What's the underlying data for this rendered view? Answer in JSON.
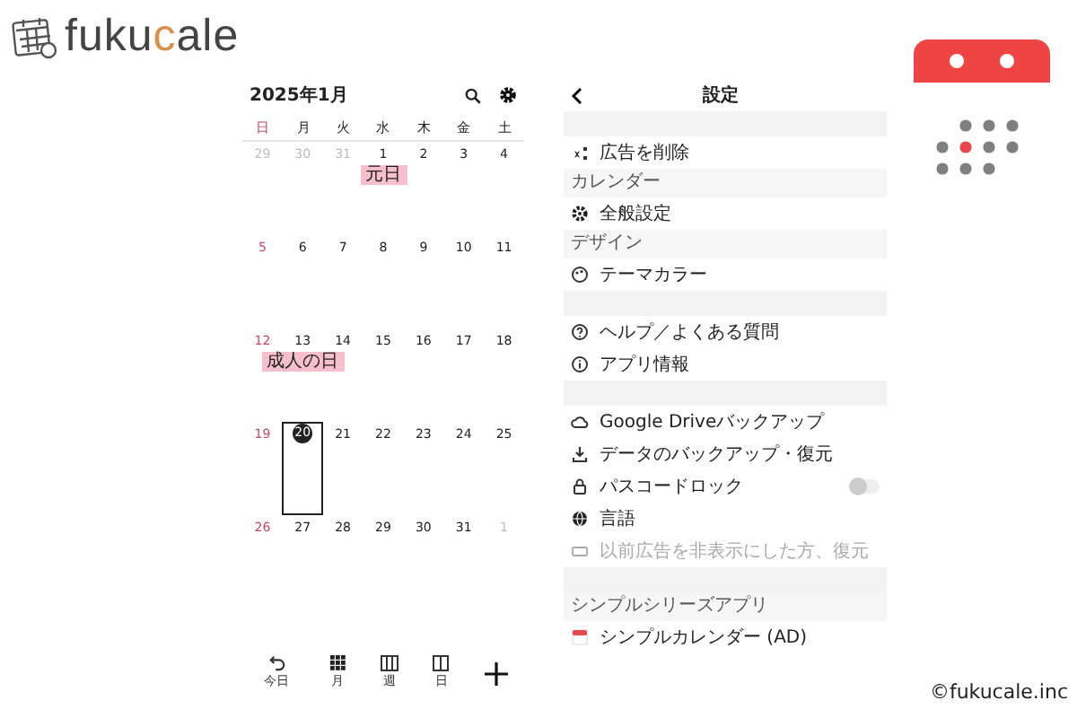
{
  "logo": {
    "before": "fuku",
    "accent": "c",
    "after": "ale"
  },
  "calendar": {
    "title": "2025年1月",
    "weekdays": [
      {
        "label": "日",
        "kind": "sunday"
      },
      {
        "label": "月",
        "kind": "weekday"
      },
      {
        "label": "火",
        "kind": "weekday"
      },
      {
        "label": "水",
        "kind": "weekday"
      },
      {
        "label": "木",
        "kind": "weekday"
      },
      {
        "label": "金",
        "kind": "weekday"
      },
      {
        "label": "土",
        "kind": "weekday"
      }
    ],
    "weeks": [
      [
        {
          "label": "29",
          "kind": "other",
          "selected": false
        },
        {
          "label": "30",
          "kind": "other",
          "selected": false
        },
        {
          "label": "31",
          "kind": "other",
          "selected": false
        },
        {
          "label": "1",
          "kind": "weekday",
          "selected": false,
          "event": "元日"
        },
        {
          "label": "2",
          "kind": "weekday",
          "selected": false
        },
        {
          "label": "3",
          "kind": "weekday",
          "selected": false
        },
        {
          "label": "4",
          "kind": "weekday",
          "selected": false
        }
      ],
      [
        {
          "label": "5",
          "kind": "sunday",
          "selected": false
        },
        {
          "label": "6",
          "kind": "weekday",
          "selected": false
        },
        {
          "label": "7",
          "kind": "weekday",
          "selected": false
        },
        {
          "label": "8",
          "kind": "weekday",
          "selected": false
        },
        {
          "label": "9",
          "kind": "weekday",
          "selected": false
        },
        {
          "label": "10",
          "kind": "weekday",
          "selected": false
        },
        {
          "label": "11",
          "kind": "weekday",
          "selected": false
        }
      ],
      [
        {
          "label": "12",
          "kind": "sunday",
          "selected": false
        },
        {
          "label": "13",
          "kind": "weekday",
          "selected": false,
          "event": "成人の日"
        },
        {
          "label": "14",
          "kind": "weekday",
          "selected": false
        },
        {
          "label": "15",
          "kind": "weekday",
          "selected": false
        },
        {
          "label": "16",
          "kind": "weekday",
          "selected": false
        },
        {
          "label": "17",
          "kind": "weekday",
          "selected": false
        },
        {
          "label": "18",
          "kind": "weekday",
          "selected": false
        }
      ],
      [
        {
          "label": "19",
          "kind": "sunday",
          "selected": false
        },
        {
          "label": "20",
          "kind": "weekday",
          "selected": true
        },
        {
          "label": "21",
          "kind": "weekday",
          "selected": false
        },
        {
          "label": "22",
          "kind": "weekday",
          "selected": false
        },
        {
          "label": "23",
          "kind": "weekday",
          "selected": false
        },
        {
          "label": "24",
          "kind": "weekday",
          "selected": false
        },
        {
          "label": "25",
          "kind": "weekday",
          "selected": false
        }
      ],
      [
        {
          "label": "26",
          "kind": "sunday",
          "selected": false
        },
        {
          "label": "27",
          "kind": "weekday",
          "selected": false
        },
        {
          "label": "28",
          "kind": "weekday",
          "selected": false
        },
        {
          "label": "29",
          "kind": "weekday",
          "selected": false
        },
        {
          "label": "30",
          "kind": "weekday",
          "selected": false
        },
        {
          "label": "31",
          "kind": "weekday",
          "selected": false
        },
        {
          "label": "1",
          "kind": "other",
          "selected": false
        }
      ]
    ],
    "toolbar": [
      {
        "label": "今日",
        "kind": "today"
      },
      {
        "label": "月",
        "kind": "month"
      },
      {
        "label": "週",
        "kind": "week"
      },
      {
        "label": "日",
        "kind": "day"
      }
    ]
  },
  "settings": {
    "title": "設定",
    "rows": [
      {
        "kind": "band"
      },
      {
        "kind": "item",
        "label": "広告を削除",
        "disabled": false
      },
      {
        "kind": "section",
        "label": "カレンダー"
      },
      {
        "kind": "item",
        "label": "全般設定",
        "disabled": false
      },
      {
        "kind": "section",
        "label": "デザイン"
      },
      {
        "kind": "item",
        "label": "テーマカラー",
        "disabled": false
      },
      {
        "kind": "band"
      },
      {
        "kind": "item",
        "label": "ヘルプ／よくある質問",
        "disabled": false
      },
      {
        "kind": "item",
        "label": "アプリ情報",
        "disabled": false
      },
      {
        "kind": "band"
      },
      {
        "kind": "item",
        "label": "Google Driveバックアップ",
        "disabled": false
      },
      {
        "kind": "item",
        "label": "データのバックアップ・復元",
        "disabled": false
      },
      {
        "kind": "item",
        "label": "パスコードロック",
        "disabled": false,
        "toggle": {
          "on": false
        }
      },
      {
        "kind": "item",
        "label": "言語",
        "disabled": false
      },
      {
        "kind": "item",
        "label": "以前広告を非表示にした方、復元",
        "disabled": true
      },
      {
        "kind": "band"
      },
      {
        "kind": "section",
        "label": "シンプルシリーズアプリ"
      },
      {
        "kind": "item",
        "label": "シンプルカレンダー (AD)",
        "disabled": false
      }
    ]
  },
  "copyright": "©fukucale.inc"
}
